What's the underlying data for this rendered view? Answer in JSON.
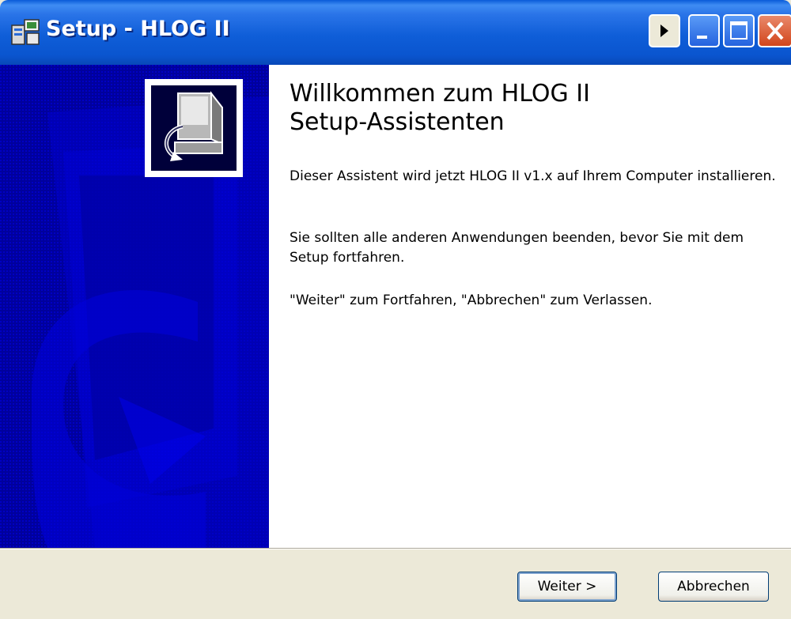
{
  "window": {
    "title": "Setup - HLOG II",
    "help_button": "help-arrow",
    "minimize_button": "minimize",
    "maximize_button": "maximize",
    "close_button": "close"
  },
  "welcome": {
    "title_line1": "Willkommen zum HLOG II",
    "title_line2": "Setup-Assistenten",
    "paragraph1": "Dieser Assistent wird jetzt HLOG II v1.x auf Ihrem Computer installieren.",
    "paragraph2": "Sie sollten alle anderen Anwendungen beenden, bevor Sie mit dem Setup fortfahren.",
    "paragraph3": "\"Weiter\" zum Fortfahren, \"Abbrechen\" zum Verlassen."
  },
  "buttons": {
    "next": "Weiter >",
    "cancel": "Abbrechen"
  },
  "colors": {
    "titlebar": "#0a55cf",
    "side_panel": "#00009a",
    "footer": "#ece9d8"
  },
  "icons": [
    "setup-app-icon",
    "help-arrow-icon",
    "minimize-icon",
    "maximize-icon",
    "close-icon",
    "computer-install-icon"
  ]
}
